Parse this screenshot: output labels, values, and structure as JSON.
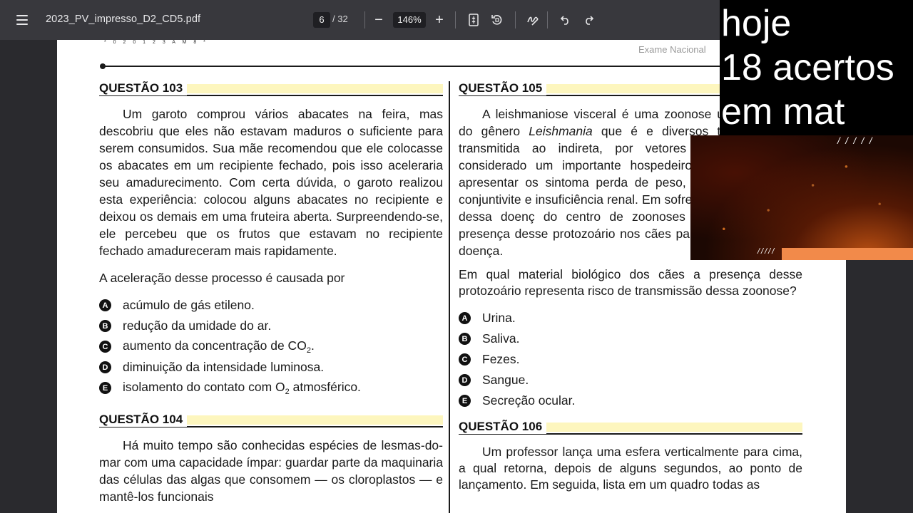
{
  "toolbar": {
    "menu_icon": "hamburger-menu-icon",
    "file_name": "2023_PV_impresso_D2_CD5.pdf",
    "page_current": "6",
    "page_total": "/ 32",
    "zoom_out": "−",
    "zoom_level": "146%",
    "zoom_in": "+",
    "icons": [
      "fit-page-icon",
      "rotate-icon",
      "draw-icon",
      "undo-icon",
      "redo-icon"
    ]
  },
  "page": {
    "barcode_text": "* 0 2 0 1 2 3 A M 8 *",
    "header_right": "Exame Nacional",
    "q103": {
      "title": "QUESTÃO 103",
      "lines": [
        "Um garoto comprou vários abacates na feira, mas",
        "descobriu que eles não estavam maduros o suficiente",
        "para serem consumidos. Sua mãe recomendou que",
        "ele colocasse os abacates em um recipiente fechado,",
        "pois isso aceleraria seu amadurecimento. Com certa",
        "dúvida, o garoto realizou esta experiência: colocou",
        "alguns abacates no recipiente e deixou os demais em",
        "uma fruteira aberta. Surpreendendo-se, ele percebeu",
        "que os frutos que estavam no recipiente fechado",
        "amadureceram mais rapidamente."
      ],
      "prompt": "A aceleração desse processo é causada por",
      "options": [
        {
          "letter": "A",
          "text": "acúmulo de gás etileno."
        },
        {
          "letter": "B",
          "text": "redução da umidade do ar."
        },
        {
          "letter": "C",
          "text": "aumento da concentração de CO",
          "sub": "2",
          "after": "."
        },
        {
          "letter": "D",
          "text": "diminuição da intensidade luminosa."
        },
        {
          "letter": "E",
          "text": "isolamento do contato com O",
          "sub": "2",
          "after": " atmosférico."
        }
      ]
    },
    "q104": {
      "title": "QUESTÃO 104",
      "lines": [
        "Há muito tempo são conhecidas espécies de",
        "lesmas-do-mar com uma capacidade ímpar: guardar",
        "parte da maquinaria das células das algas que",
        "consomem — os cloroplastos — e mantê-los funcionais"
      ]
    },
    "q105": {
      "title": "QUESTÃO 105",
      "lines": [
        "A leishmaniose visceral é uma zoonose",
        "um protozoário do gênero Leishmania que é e",
        "diversos tecidos. Ela é transmitida ao",
        "indireta, por vetores do ambiente do",
        "considerado um importante hospedeiro",
        "podendo ou não apresentar os sintoma",
        "perda de peso, anemia, ferimentos",
        "conjuntivite e insuficiência renal. Em",
        "sofre com alta incidência dessa doenç",
        "do centro de zoonoses buscou verificar a presença desse",
        "protozoário nos cães para tentar controlar a doença."
      ],
      "prompt": "Em qual material biológico dos cães a presença desse protozoário representa risco de transmissão dessa zoonose?",
      "options": [
        {
          "letter": "A",
          "text": "Urina."
        },
        {
          "letter": "B",
          "text": "Saliva."
        },
        {
          "letter": "C",
          "text": "Fezes."
        },
        {
          "letter": "D",
          "text": "Sangue."
        },
        {
          "letter": "E",
          "text": "Secreção ocular."
        }
      ]
    },
    "q106": {
      "title": "QUESTÃO 106",
      "lines": [
        "Um professor lança uma esfera verticalmente para",
        "cima, a qual retorna, depois de alguns segundos, ao ponto",
        "de lançamento. Em seguida, lista em um quadro todas as"
      ]
    }
  },
  "overlay": {
    "lines": [
      "hoje",
      "18 acertos",
      "em mat"
    ]
  },
  "colors": {
    "toolbar_bg": "#38383d",
    "viewer_bg": "#2a2a2e",
    "question_band": "#fdf6be",
    "overlay_bg": "#000000",
    "ember_accent": "#f28a4a"
  }
}
